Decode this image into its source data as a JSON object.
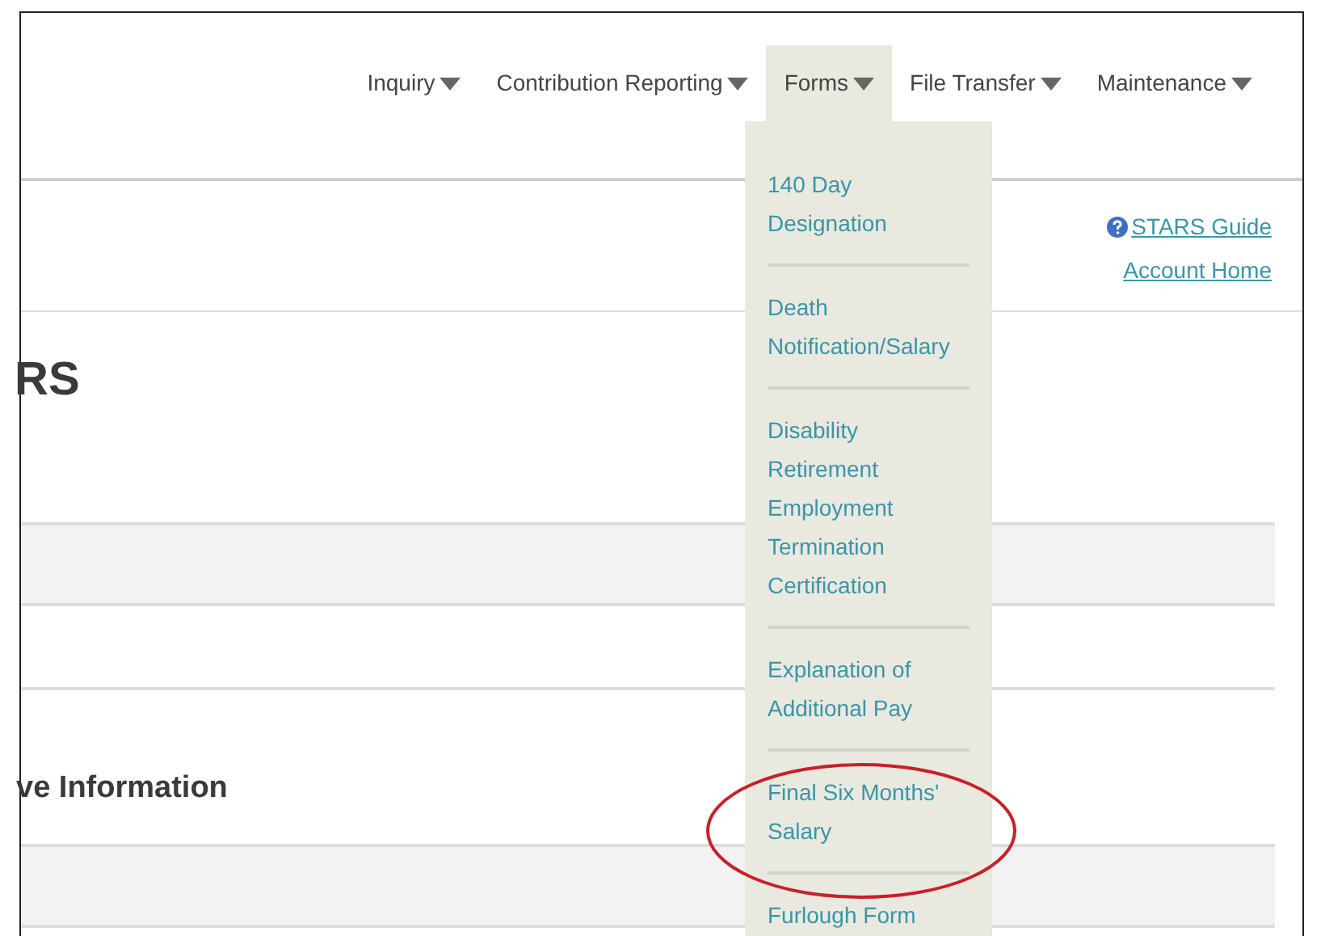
{
  "nav": [
    {
      "label": "Inquiry",
      "selected": false
    },
    {
      "label": "Contribution Reporting",
      "selected": false
    },
    {
      "label": "Forms",
      "selected": true
    },
    {
      "label": "File Transfer",
      "selected": false
    },
    {
      "label": "Maintenance",
      "selected": false
    }
  ],
  "dropdown": [
    {
      "label": "140 Day Designation",
      "circled": false
    },
    {
      "label": "Death Notification/Salary",
      "circled": false
    },
    {
      "label": "Disability Retirement Employment Termination Certification",
      "circled": false
    },
    {
      "label": "Explanation of Additional Pay",
      "circled": false
    },
    {
      "label": "Final Six Months' Salary",
      "circled": true
    },
    {
      "label": "Furlough Form",
      "circled": false
    }
  ],
  "links": [
    {
      "label": "STARS Guide",
      "kind": "help"
    },
    {
      "label": "Account Home",
      "kind": "plain"
    }
  ],
  "page_heading": "RS",
  "section_heading": "ve Information"
}
